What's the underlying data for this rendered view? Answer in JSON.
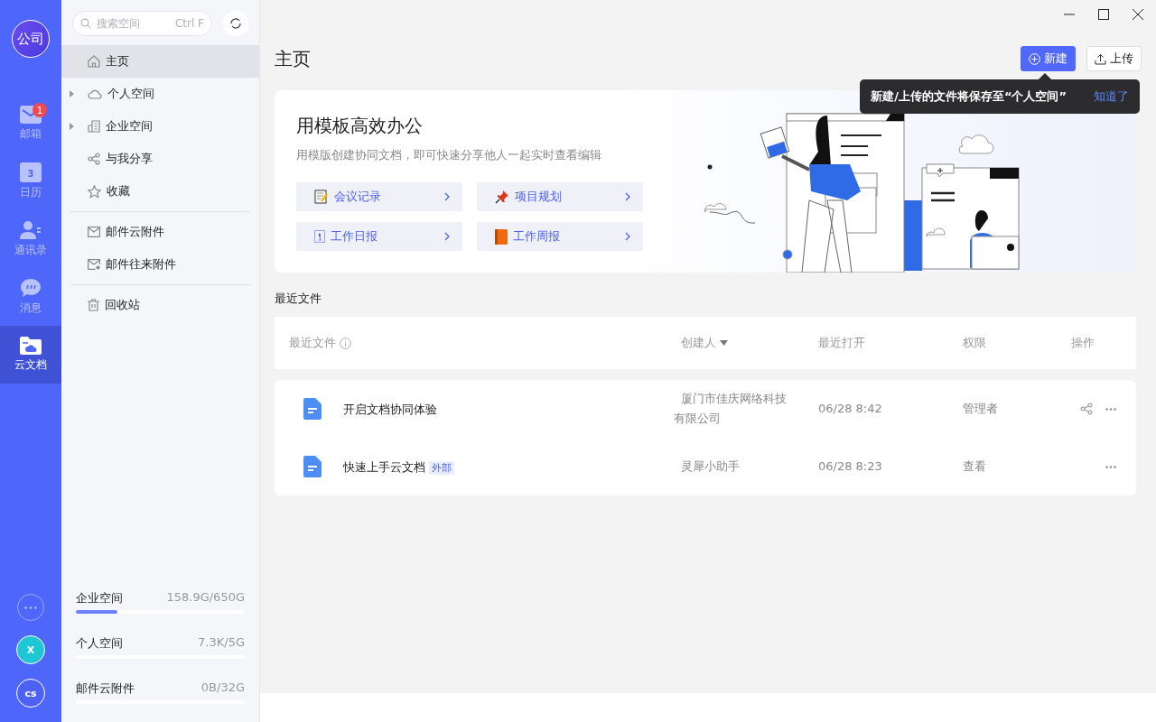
{
  "rail": {
    "logo": "公司",
    "items": [
      {
        "kind": "mail",
        "label": "邮箱",
        "badge": "1",
        "selected": false
      },
      {
        "kind": "calendar",
        "label": "日历",
        "day": "3",
        "selected": false
      },
      {
        "kind": "contacts",
        "label": "通讯录",
        "selected": false
      },
      {
        "kind": "chat",
        "label": "消息",
        "selected": false
      },
      {
        "kind": "docs",
        "label": "云文档",
        "selected": true
      }
    ],
    "avatars": [
      {
        "kind": "more"
      },
      {
        "kind": "user",
        "initial": "X",
        "color": "#1fc6d4"
      },
      {
        "kind": "user",
        "initial": "cs",
        "color": "#4d62f5"
      }
    ]
  },
  "sidebar": {
    "search": {
      "placeholder": "搜索空间",
      "shortcut": "Ctrl F"
    },
    "groups": [
      [
        {
          "kind": "home",
          "label": "主页",
          "selected": true,
          "expandable": false
        },
        {
          "kind": "cloud",
          "label": "个人空间",
          "selected": false,
          "expandable": true
        },
        {
          "kind": "building",
          "label": "企业空间",
          "selected": false,
          "expandable": true
        },
        {
          "kind": "share",
          "label": "与我分享",
          "selected": false,
          "expandable": false
        },
        {
          "kind": "star",
          "label": "收藏",
          "selected": false,
          "expandable": false
        }
      ],
      [
        {
          "kind": "mail",
          "label": "邮件云附件",
          "selected": false,
          "expandable": false
        },
        {
          "kind": "mailexchange",
          "label": "邮件往来附件",
          "selected": false,
          "expandable": false
        }
      ],
      [
        {
          "kind": "trash",
          "label": "回收站",
          "selected": false,
          "expandable": false
        }
      ]
    ],
    "storage": [
      {
        "label": "企业空间",
        "reading": "158.9G/650G",
        "level": 0.245
      },
      {
        "label": "个人空间",
        "reading": "7.3K/5G"
      },
      {
        "label": "邮件云附件",
        "reading": "0B/32G"
      }
    ]
  },
  "main": {
    "title": "主页",
    "buttons": [
      {
        "kind": "primary",
        "label": "新建"
      },
      {
        "kind": "secondary",
        "label": "上传"
      }
    ],
    "tooltip": {
      "text": "新建/上传的文件将保存至“个人空间”",
      "link": "知道了"
    },
    "banner": {
      "title": "用模板高效办公",
      "subtitle": "用模版创建协同文档，即可快速分享他人一起实时查看编辑",
      "templates": [
        {
          "kind": "memo",
          "label": "会议记录"
        },
        {
          "kind": "pin",
          "label": "项目规划"
        },
        {
          "kind": "calendar",
          "label": "工作日报"
        },
        {
          "kind": "book",
          "label": "工作周报"
        }
      ]
    },
    "section_title": "最近文件",
    "table": {
      "columns": [
        {
          "label": "最近文件",
          "info": true,
          "sortable": false
        },
        {
          "label": "创建人",
          "info": false,
          "sortable": true
        },
        {
          "label": "最近打开",
          "info": false,
          "sortable": false
        },
        {
          "label": "权限",
          "info": false,
          "sortable": false
        },
        {
          "label": "操作",
          "info": false,
          "sortable": false
        }
      ],
      "rows": [
        {
          "name": "开启文档协同体验",
          "creator": "厦门市佳庆网络科技有限公司",
          "opened": "06/28 8:42",
          "permission": "管理者",
          "share": true
        },
        {
          "name": "快速上手云文档",
          "tag": "外部",
          "creator": "灵犀小助手",
          "opened": "06/28 8:23",
          "permission": "查看",
          "share": false
        }
      ]
    }
  }
}
